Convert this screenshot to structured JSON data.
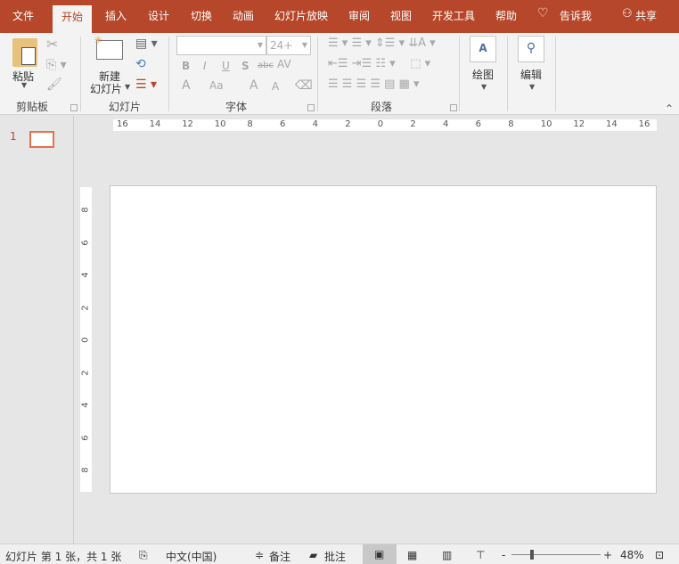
{
  "tabs": [
    "文件",
    "开始",
    "插入",
    "设计",
    "切换",
    "动画",
    "幻灯片放映",
    "审阅",
    "视图",
    "开发工具",
    "帮助"
  ],
  "tell_me": "告诉我",
  "share": "共享",
  "ribbon": {
    "clipboard": {
      "label": "剪贴板",
      "paste": "粘贴"
    },
    "slides": {
      "label": "幻灯片",
      "new_slide_1": "新建",
      "new_slide_2": "幻灯片"
    },
    "font": {
      "label": "字体",
      "font_name": "",
      "font_size": "24+",
      "bold": "B",
      "italic": "I",
      "underline": "U",
      "shadow": "S",
      "strike": "abc",
      "spacing": "AV",
      "color": "A",
      "case": "Aa",
      "grow": "A",
      "shrink": "A"
    },
    "paragraph": {
      "label": "段落"
    },
    "drawing": {
      "label": "绘图"
    },
    "editing": {
      "label": "编辑"
    }
  },
  "thumbnail": {
    "number": "1"
  },
  "hruler": [
    "16",
    "14",
    "12",
    "10",
    "8",
    "6",
    "4",
    "2",
    "0",
    "2",
    "4",
    "6",
    "8",
    "10",
    "12",
    "14",
    "16"
  ],
  "vruler": [
    "8",
    "6",
    "4",
    "2",
    "0",
    "2",
    "4",
    "6",
    "8"
  ],
  "status": {
    "slide_info": "幻灯片 第 1 张，共 1 张",
    "language": "中文(中国)",
    "notes": "备注",
    "comments": "批注",
    "zoom": "48%"
  },
  "colors": {
    "accent": "#b7472a"
  }
}
